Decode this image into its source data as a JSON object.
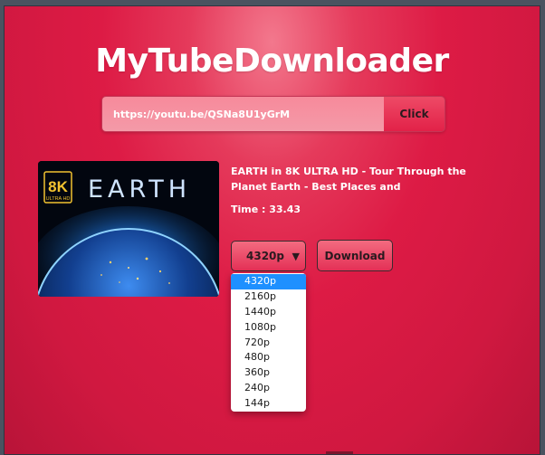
{
  "app": {
    "title": "MyTubeDownloader"
  },
  "url_bar": {
    "value": "https://youtu.be/QSNa8U1yGrM",
    "click_label": "Click"
  },
  "thumbnail": {
    "badge_top": "8K",
    "badge_bottom": "ULTRA HD",
    "word": "EARTH"
  },
  "video": {
    "title": "EARTH in 8K ULTRA HD - Tour Through the Planet Earth - Best Places and",
    "time": "Time : 33.43"
  },
  "quality": {
    "selected": "4320p",
    "options": [
      "4320p",
      "2160p",
      "1440p",
      "1080p",
      "720p",
      "480p",
      "360p",
      "240p",
      "144p"
    ]
  },
  "download": {
    "label": "Download"
  },
  "colors": {
    "accent": "#dd1b45",
    "selected_option": "#1e90ff"
  }
}
